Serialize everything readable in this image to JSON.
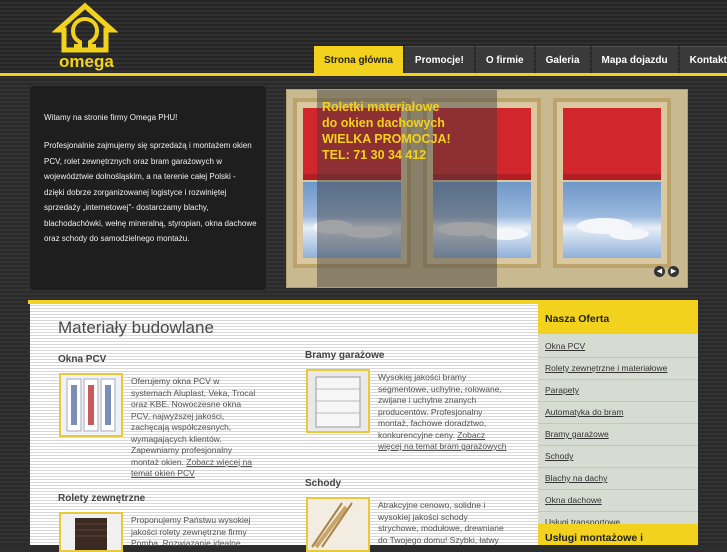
{
  "logo": {
    "text": "omega"
  },
  "nav": {
    "items": [
      {
        "label": "Strona główna",
        "active": true
      },
      {
        "label": "Promocje!",
        "active": false
      },
      {
        "label": "O firmie",
        "active": false
      },
      {
        "label": "Galeria",
        "active": false
      },
      {
        "label": "Mapa dojazdu",
        "active": false
      },
      {
        "label": "Kontakt",
        "active": false
      }
    ]
  },
  "welcome": {
    "greeting": "Witamy na stronie firmy Omega PHU!",
    "body": "Profesjonalnie zajmujemy się sprzedażą i montażem okien PCV, rolet zewnętrznych oraz bram garażowych w województwie dolnośląskim, a na terenie całej Polski - dzięki dobrze zorganizowanej logistyce i rozwiniętej sprzedaży „internetowej\"- dostarczamy blachy, blachodachówki, wełnę mineralną, styropian, okna dachowe oraz schody do samodzielnego montażu."
  },
  "banner": {
    "line1": "Roletki materiałowe",
    "line2": "do okien dachowych",
    "line3": "WIELKA PROMOCJA!",
    "line4": "TEL: 71 30 34 412",
    "prev_icon": "arrow-left-icon",
    "next_icon": "arrow-right-icon"
  },
  "main": {
    "title": "Materiały budowlane",
    "products": [
      {
        "title": "Okna PCV",
        "text": "Oferujemy okna PCV w systemach Aluplast, Veka, Trocal oraz KBE. Nowoczesne okna PCV, najwyższej jakości, zachęcają współczesnych, wymagających klientów. Zapewniamy profesjonalny montaż okien.",
        "link": "Zobacz więcej na temat okien PCV"
      },
      {
        "title": "Bramy garażowe",
        "text": "Wysokiej jakości bramy segmentowe, uchylne, rolowane, zwijane i uchylne znanych producentów. Profesjonalny montaż, fachowe doradztwo, konkurencyjne ceny.",
        "link": "Zobacz więcej na temat bram garażowych"
      },
      {
        "title": "Rolety zewnętrzne",
        "text": "Proponujemy Państwu wysokiej jakości rolety zewnętrzne firmy Pomba. Rozwiązanie idealne"
      },
      {
        "title": "Schody",
        "text": "Atrakcyjne cenowo, solidne i wysokiej jakości schody strychowe, modułowe, drewniane do Twojego domu! Szybki, łatwy"
      }
    ]
  },
  "sidebar": {
    "heading": "Nasza Oferta",
    "items": [
      "Okna PCV",
      "Rolety zewnętrzne i materiałowe",
      "Parapety",
      "Automatyka do bram",
      "Bramy garażowe",
      "Schody",
      "Blachy na dachy",
      "Okna dachowe",
      "Usługi transportowe"
    ],
    "heading2": "Usługi montażowe i"
  },
  "colors": {
    "accent": "#f3d21d",
    "dark": "#2d2d2d",
    "sidebar": "#d7dcd2"
  }
}
